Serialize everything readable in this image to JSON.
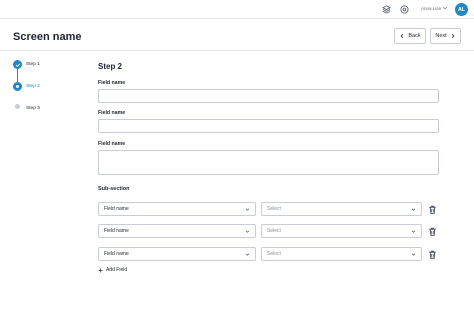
{
  "topbar": {
    "icons": [
      "stack-icon",
      "help-circle-icon"
    ],
    "user_name": "Anna Lian",
    "avatar_initials": "AL",
    "accent_color": "#1e88c8"
  },
  "header": {
    "title": "Screen name",
    "back_label": "Back",
    "next_label": "Next"
  },
  "stepper": {
    "steps": [
      {
        "label": "Step 1",
        "state": "completed"
      },
      {
        "label": "Step 2",
        "state": "active"
      },
      {
        "label": "Step 3",
        "state": "pending"
      }
    ]
  },
  "form": {
    "title": "Step 2",
    "fields": [
      {
        "label": "Field name",
        "value": ""
      },
      {
        "label": "Field name",
        "value": ""
      },
      {
        "label": "Field name",
        "value": ""
      }
    ],
    "subsection": {
      "title": "Sub-section",
      "rows": [
        {
          "field": "Field name",
          "select_placeholder": "Select"
        },
        {
          "field": "Field name",
          "select_placeholder": "Select"
        },
        {
          "field": "Field name",
          "select_placeholder": "Select"
        }
      ],
      "add_label": "Add Field"
    }
  }
}
